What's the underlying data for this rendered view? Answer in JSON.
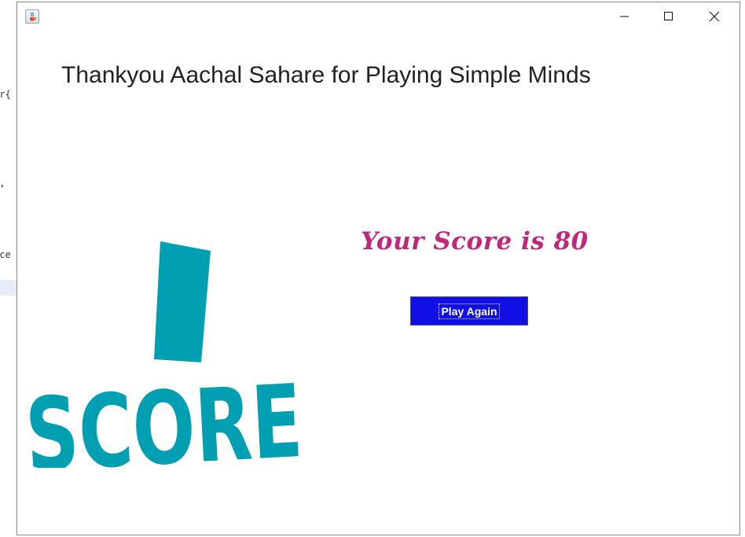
{
  "background": {
    "code_fragments": [
      "er{",
      "h,",
      "rce"
    ]
  },
  "window": {
    "title": "",
    "app_icon": "java-cup-icon",
    "controls": {
      "minimize": "minimize-icon",
      "maximize": "maximize-icon",
      "close": "close-icon"
    }
  },
  "main": {
    "thanks_message": "Thankyou Aachal Sahare for Playing Simple Minds",
    "score_message": "Your Score is 80",
    "play_again_label": "Play Again",
    "score_graphic_text": "SCORE"
  },
  "colors": {
    "score_text": "#c0287a",
    "button_bg": "#0f0fe6",
    "graphic": "#009fb2"
  }
}
